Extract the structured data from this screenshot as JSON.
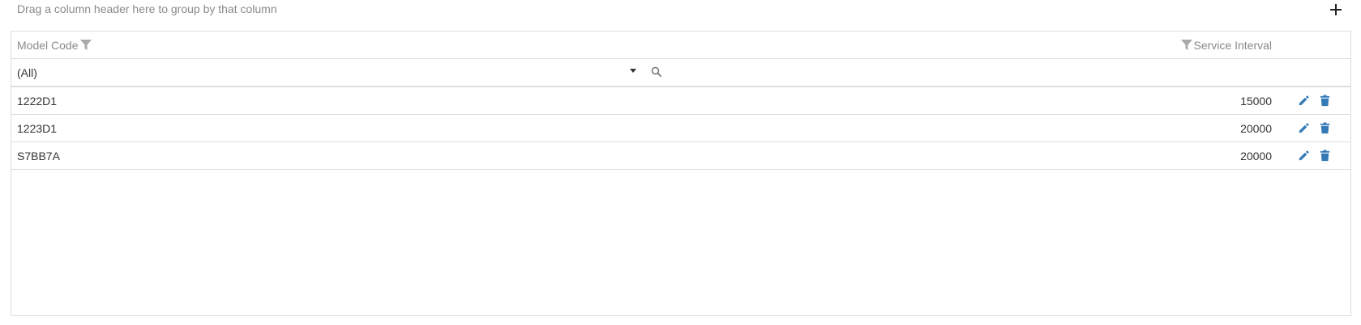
{
  "group_panel": {
    "hint": "Drag a column header here to group by that column",
    "add_icon": "plus-icon"
  },
  "grid": {
    "columns": {
      "model_code": "Model Code",
      "service_interval": "Service Interval"
    },
    "filter": {
      "model_code_value": "(All)"
    },
    "rows": [
      {
        "model_code": "1222D1",
        "service_interval": "15000"
      },
      {
        "model_code": "1223D1",
        "service_interval": "20000"
      },
      {
        "model_code": "S7BB7A",
        "service_interval": "20000"
      }
    ]
  },
  "colors": {
    "accent": "#337ab7",
    "muted_text": "#8a8a8a",
    "border": "#dddddd",
    "filter_icon": "#a9a9a9"
  }
}
